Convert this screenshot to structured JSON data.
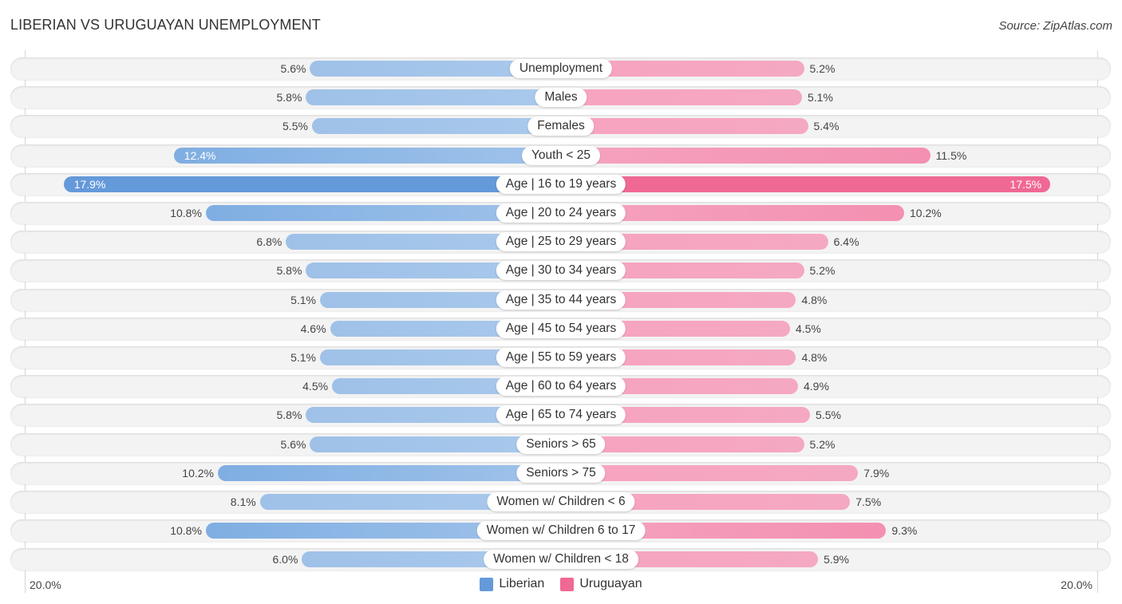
{
  "header": {
    "title": "LIBERIAN VS URUGUAYAN UNEMPLOYMENT",
    "source": "Source: ZipAtlas.com"
  },
  "colors": {
    "liberian": "#6499da",
    "uruguayan": "#f06894"
  },
  "chart_data": {
    "type": "bar",
    "orientation": "horizontal-diverging",
    "title": "LIBERIAN VS URUGUAYAN UNEMPLOYMENT",
    "xlabel": "",
    "ylabel": "",
    "xlim": [
      0,
      20.0
    ],
    "axis_tick_labels": {
      "left": "20.0%",
      "right": "20.0%"
    },
    "legend": {
      "position": "bottom-center",
      "entries": [
        "Liberian",
        "Uruguayan"
      ]
    },
    "categories": [
      "Unemployment",
      "Males",
      "Females",
      "Youth < 25",
      "Age | 16 to 19 years",
      "Age | 20 to 24 years",
      "Age | 25 to 29 years",
      "Age | 30 to 34 years",
      "Age | 35 to 44 years",
      "Age | 45 to 54 years",
      "Age | 55 to 59 years",
      "Age | 60 to 64 years",
      "Age | 65 to 74 years",
      "Seniors > 65",
      "Seniors > 75",
      "Women w/ Children < 6",
      "Women w/ Children 6 to 17",
      "Women w/ Children < 18"
    ],
    "series": [
      {
        "name": "Liberian",
        "side": "left",
        "values": [
          5.6,
          5.8,
          5.5,
          12.4,
          17.9,
          10.8,
          6.8,
          5.8,
          5.1,
          4.6,
          5.1,
          4.5,
          5.8,
          5.6,
          10.2,
          8.1,
          10.8,
          6.0
        ],
        "labels": [
          "5.6%",
          "5.8%",
          "5.5%",
          "12.4%",
          "17.9%",
          "10.8%",
          "6.8%",
          "5.8%",
          "5.1%",
          "4.6%",
          "5.1%",
          "4.5%",
          "5.8%",
          "5.6%",
          "10.2%",
          "8.1%",
          "10.8%",
          "6.0%"
        ]
      },
      {
        "name": "Uruguayan",
        "side": "right",
        "values": [
          5.2,
          5.1,
          5.4,
          11.5,
          17.5,
          10.2,
          6.4,
          5.2,
          4.8,
          4.5,
          4.8,
          4.9,
          5.5,
          5.2,
          7.9,
          7.5,
          9.3,
          5.9
        ],
        "labels": [
          "5.2%",
          "5.1%",
          "5.4%",
          "11.5%",
          "17.5%",
          "10.2%",
          "6.4%",
          "5.2%",
          "4.8%",
          "4.5%",
          "4.8%",
          "4.9%",
          "5.5%",
          "5.2%",
          "7.9%",
          "7.5%",
          "9.3%",
          "5.9%"
        ]
      }
    ]
  }
}
